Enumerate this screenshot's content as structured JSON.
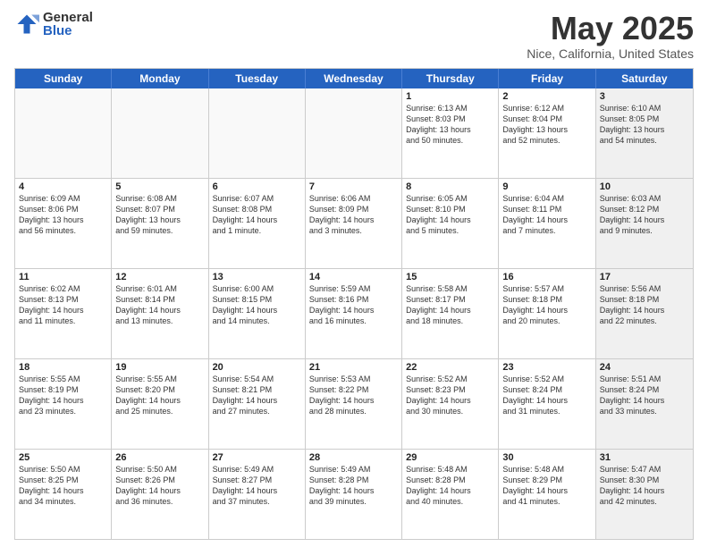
{
  "logo": {
    "general": "General",
    "blue": "Blue"
  },
  "title": "May 2025",
  "location": "Nice, California, United States",
  "days": [
    "Sunday",
    "Monday",
    "Tuesday",
    "Wednesday",
    "Thursday",
    "Friday",
    "Saturday"
  ],
  "weeks": [
    [
      {
        "date": "",
        "info": ""
      },
      {
        "date": "",
        "info": ""
      },
      {
        "date": "",
        "info": ""
      },
      {
        "date": "",
        "info": ""
      },
      {
        "date": "1",
        "info": "Sunrise: 6:13 AM\nSunset: 8:03 PM\nDaylight: 13 hours\nand 50 minutes."
      },
      {
        "date": "2",
        "info": "Sunrise: 6:12 AM\nSunset: 8:04 PM\nDaylight: 13 hours\nand 52 minutes."
      },
      {
        "date": "3",
        "info": "Sunrise: 6:10 AM\nSunset: 8:05 PM\nDaylight: 13 hours\nand 54 minutes."
      }
    ],
    [
      {
        "date": "4",
        "info": "Sunrise: 6:09 AM\nSunset: 8:06 PM\nDaylight: 13 hours\nand 56 minutes."
      },
      {
        "date": "5",
        "info": "Sunrise: 6:08 AM\nSunset: 8:07 PM\nDaylight: 13 hours\nand 59 minutes."
      },
      {
        "date": "6",
        "info": "Sunrise: 6:07 AM\nSunset: 8:08 PM\nDaylight: 14 hours\nand 1 minute."
      },
      {
        "date": "7",
        "info": "Sunrise: 6:06 AM\nSunset: 8:09 PM\nDaylight: 14 hours\nand 3 minutes."
      },
      {
        "date": "8",
        "info": "Sunrise: 6:05 AM\nSunset: 8:10 PM\nDaylight: 14 hours\nand 5 minutes."
      },
      {
        "date": "9",
        "info": "Sunrise: 6:04 AM\nSunset: 8:11 PM\nDaylight: 14 hours\nand 7 minutes."
      },
      {
        "date": "10",
        "info": "Sunrise: 6:03 AM\nSunset: 8:12 PM\nDaylight: 14 hours\nand 9 minutes."
      }
    ],
    [
      {
        "date": "11",
        "info": "Sunrise: 6:02 AM\nSunset: 8:13 PM\nDaylight: 14 hours\nand 11 minutes."
      },
      {
        "date": "12",
        "info": "Sunrise: 6:01 AM\nSunset: 8:14 PM\nDaylight: 14 hours\nand 13 minutes."
      },
      {
        "date": "13",
        "info": "Sunrise: 6:00 AM\nSunset: 8:15 PM\nDaylight: 14 hours\nand 14 minutes."
      },
      {
        "date": "14",
        "info": "Sunrise: 5:59 AM\nSunset: 8:16 PM\nDaylight: 14 hours\nand 16 minutes."
      },
      {
        "date": "15",
        "info": "Sunrise: 5:58 AM\nSunset: 8:17 PM\nDaylight: 14 hours\nand 18 minutes."
      },
      {
        "date": "16",
        "info": "Sunrise: 5:57 AM\nSunset: 8:18 PM\nDaylight: 14 hours\nand 20 minutes."
      },
      {
        "date": "17",
        "info": "Sunrise: 5:56 AM\nSunset: 8:18 PM\nDaylight: 14 hours\nand 22 minutes."
      }
    ],
    [
      {
        "date": "18",
        "info": "Sunrise: 5:55 AM\nSunset: 8:19 PM\nDaylight: 14 hours\nand 23 minutes."
      },
      {
        "date": "19",
        "info": "Sunrise: 5:55 AM\nSunset: 8:20 PM\nDaylight: 14 hours\nand 25 minutes."
      },
      {
        "date": "20",
        "info": "Sunrise: 5:54 AM\nSunset: 8:21 PM\nDaylight: 14 hours\nand 27 minutes."
      },
      {
        "date": "21",
        "info": "Sunrise: 5:53 AM\nSunset: 8:22 PM\nDaylight: 14 hours\nand 28 minutes."
      },
      {
        "date": "22",
        "info": "Sunrise: 5:52 AM\nSunset: 8:23 PM\nDaylight: 14 hours\nand 30 minutes."
      },
      {
        "date": "23",
        "info": "Sunrise: 5:52 AM\nSunset: 8:24 PM\nDaylight: 14 hours\nand 31 minutes."
      },
      {
        "date": "24",
        "info": "Sunrise: 5:51 AM\nSunset: 8:24 PM\nDaylight: 14 hours\nand 33 minutes."
      }
    ],
    [
      {
        "date": "25",
        "info": "Sunrise: 5:50 AM\nSunset: 8:25 PM\nDaylight: 14 hours\nand 34 minutes."
      },
      {
        "date": "26",
        "info": "Sunrise: 5:50 AM\nSunset: 8:26 PM\nDaylight: 14 hours\nand 36 minutes."
      },
      {
        "date": "27",
        "info": "Sunrise: 5:49 AM\nSunset: 8:27 PM\nDaylight: 14 hours\nand 37 minutes."
      },
      {
        "date": "28",
        "info": "Sunrise: 5:49 AM\nSunset: 8:28 PM\nDaylight: 14 hours\nand 39 minutes."
      },
      {
        "date": "29",
        "info": "Sunrise: 5:48 AM\nSunset: 8:28 PM\nDaylight: 14 hours\nand 40 minutes."
      },
      {
        "date": "30",
        "info": "Sunrise: 5:48 AM\nSunset: 8:29 PM\nDaylight: 14 hours\nand 41 minutes."
      },
      {
        "date": "31",
        "info": "Sunrise: 5:47 AM\nSunset: 8:30 PM\nDaylight: 14 hours\nand 42 minutes."
      }
    ]
  ]
}
